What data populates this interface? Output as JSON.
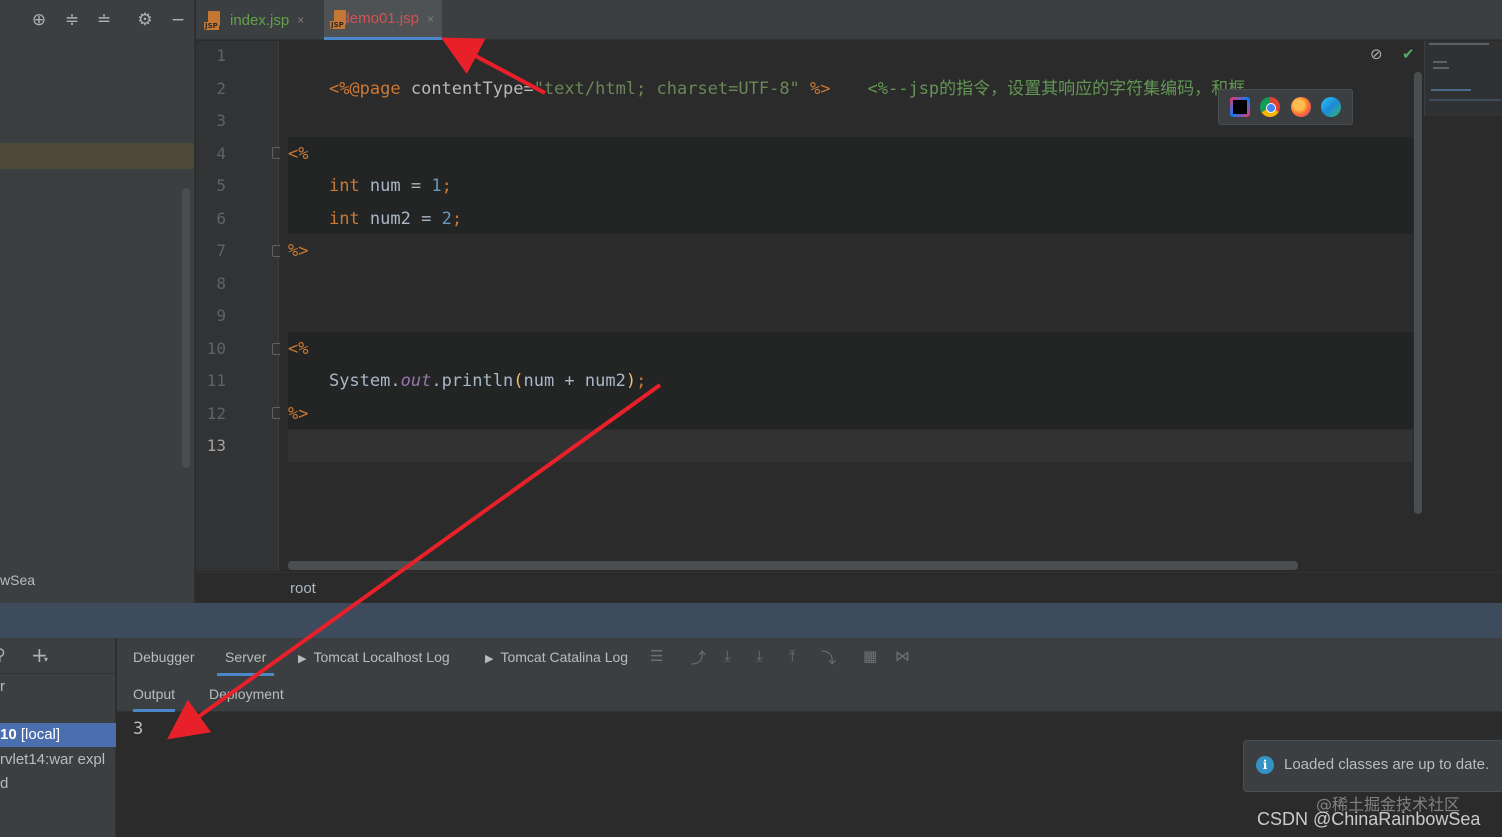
{
  "left_panel": {
    "project_label": "wSea"
  },
  "tabs": [
    {
      "label": "index.jsp",
      "icon": "jsp-file-icon",
      "close": "×"
    },
    {
      "label": "demo01.jsp",
      "icon": "jsp-file-icon",
      "close": "×"
    }
  ],
  "line_numbers": [
    "1",
    "2",
    "3",
    "4",
    "5",
    "6",
    "7",
    "8",
    "9",
    "10",
    "11",
    "12",
    "13"
  ],
  "code": {
    "line1": {
      "directive_open": "<%@page ",
      "attr": "contentType",
      "eq": "=",
      "value": "\"text/html; charset=UTF-8\"",
      "close": " %>",
      "comment": "<%--jsp的指令，设置其响应的字符集编码，和框"
    },
    "line4": "<%",
    "line5": {
      "type": "int",
      "name": " num = ",
      "num": "1",
      "semi": ";"
    },
    "line6": {
      "type": "int",
      "name": " num2 = ",
      "num": "2",
      "semi": ";"
    },
    "line7": "%>",
    "line10": "<%",
    "line11": {
      "cls": "System.",
      "field": "out",
      "call": ".println",
      "open": "(",
      "args": "num + num2",
      "close": ")",
      "semi": ";"
    },
    "line12": "%>"
  },
  "breadcrumb": "root",
  "tool_window": {
    "tabs": [
      "Debugger",
      "Server",
      "Tomcat Localhost Log",
      "Tomcat Catalina Log"
    ],
    "subtabs": [
      "Output",
      "Deployment"
    ],
    "side_items": {
      "tomcat_prefix": "10",
      "tomcat_suffix": " [local]",
      "artifact": "rvlet14:war expl",
      "third": "d"
    },
    "console_output": "3"
  },
  "notification": "Loaded classes are up to date.",
  "watermarks": [
    "@稀土掘金技术社区",
    "CSDN @ChinaRainbowSea"
  ],
  "colors": {
    "active_tab_underline": "#4a88c7",
    "annotation_arrow": "#e8202a",
    "selected_item": "#4b6eaf"
  }
}
